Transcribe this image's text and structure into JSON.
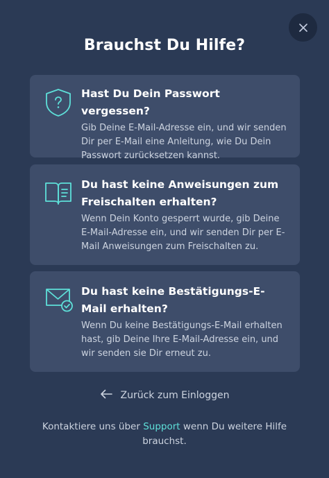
{
  "dialog": {
    "close_icon": "close-icon",
    "title": "Brauchst Du Hilfe?"
  },
  "cards": [
    {
      "icon": "shield-question-icon",
      "heading": "Hast Du Dein Passwort vergessen?",
      "description": "Gib Deine E-Mail-Adresse ein, und wir senden Dir per E-Mail eine Anleitung, wie Du Dein Passwort zurücksetzen kannst."
    },
    {
      "icon": "book-icon",
      "heading": "Du hast keine Anweisungen zum Freischalten erhalten?",
      "description": "Wenn Dein Konto gesperrt wurde, gib Deine E-Mail-Adresse ein, und wir senden Dir per E-Mail Anweisungen zum Freischalten zu."
    },
    {
      "icon": "envelope-check-icon",
      "heading": "Du hast keine Bestätigungs-E-Mail erhalten?",
      "description": "Wenn Du keine Bestätigungs-E-Mail erhalten hast, gib Deine Ihre E-Mail-Adresse ein, und wir senden sie Dir erneut zu."
    }
  ],
  "back": {
    "icon": "arrow-left-icon",
    "label": "Zurück zum Einloggen"
  },
  "footer": {
    "text_before": "Kontaktiere uns über ",
    "link_label": "Support",
    "text_after": " wenn Du weitere Hilfe brauchst."
  },
  "colors": {
    "background": "#2b3a55",
    "card": "#3e4d6a",
    "accent": "#5ee0d9",
    "close_button": "#1e2a40"
  }
}
